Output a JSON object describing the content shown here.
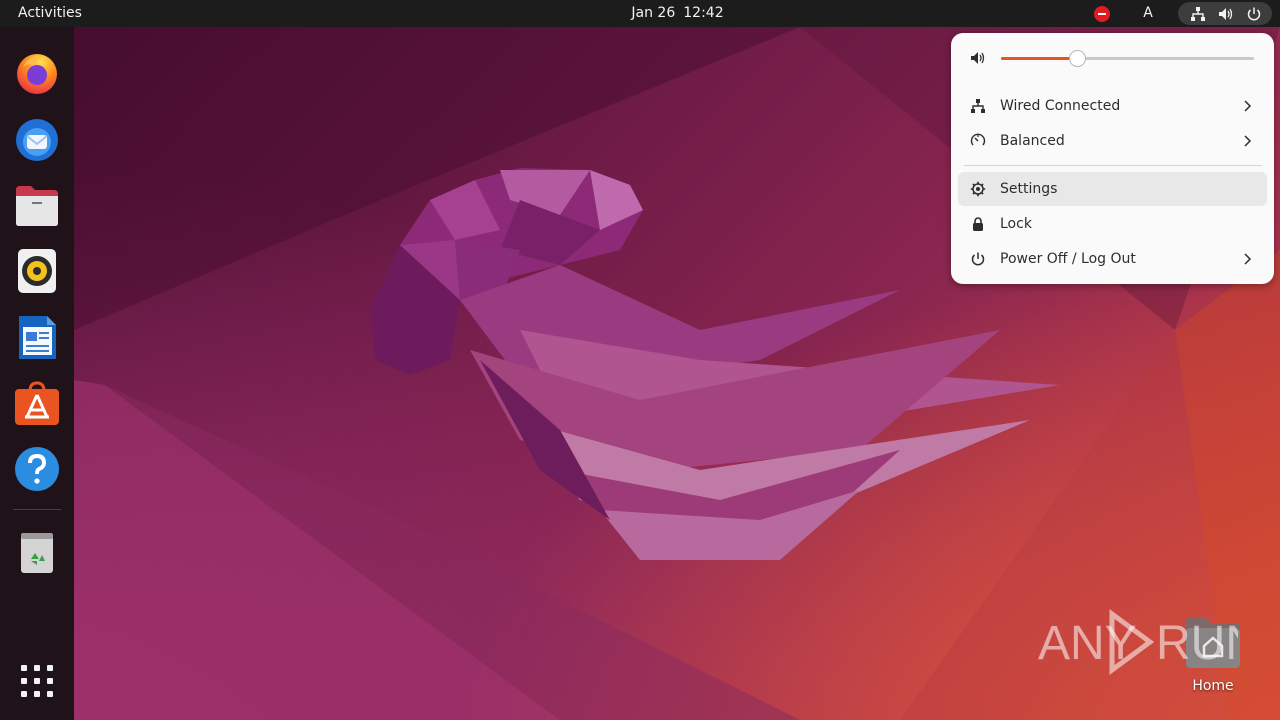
{
  "topbar": {
    "activities": "Activities",
    "date": "Jan 26",
    "time": "12:42",
    "input_source": "A",
    "tray_icons": [
      "do-not-disturb-icon",
      "network-wired-icon",
      "volume-icon",
      "power-icon"
    ]
  },
  "dock": {
    "apps": [
      {
        "name": "firefox",
        "icon": "firefox-icon"
      },
      {
        "name": "thunderbird",
        "icon": "thunderbird-icon"
      },
      {
        "name": "files",
        "icon": "files-icon"
      },
      {
        "name": "rhythmbox",
        "icon": "rhythmbox-icon"
      },
      {
        "name": "libreoffice-writer",
        "icon": "writer-icon"
      },
      {
        "name": "ubuntu-software",
        "icon": "software-icon"
      },
      {
        "name": "help",
        "icon": "help-icon"
      },
      {
        "name": "trash",
        "icon": "trash-icon"
      },
      {
        "name": "show-apps",
        "icon": "app-grid-icon"
      }
    ]
  },
  "desktop": {
    "home_label": "Home"
  },
  "quick_settings": {
    "volume_percent": 30,
    "items": [
      {
        "label": "Wired Connected",
        "icon": "network-wired-icon",
        "has_submenu": true
      },
      {
        "label": "Balanced",
        "icon": "power-profile-icon",
        "has_submenu": true
      },
      {
        "label": "Settings",
        "icon": "gear-icon",
        "has_submenu": false,
        "hovered": true
      },
      {
        "label": "Lock",
        "icon": "lock-icon",
        "has_submenu": false
      },
      {
        "label": "Power Off / Log Out",
        "icon": "power-icon",
        "has_submenu": true
      }
    ]
  },
  "watermark": {
    "text": "ANY RUN"
  },
  "colors": {
    "accent": "#e95420",
    "topbar": "#1c1c1c",
    "menu_bg": "#fafafa"
  }
}
